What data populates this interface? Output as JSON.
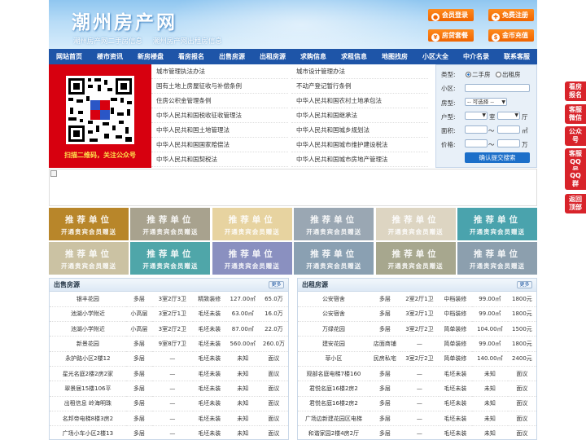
{
  "header": {
    "title": "潮州房产网",
    "subtitle": [
      "潮州房产网二手房信息",
      "潮州房产网出租房信息"
    ],
    "buttons": [
      {
        "label": "会员登录",
        "icon": "user-icon"
      },
      {
        "label": "免费注册",
        "icon": "register-icon"
      },
      {
        "label": "房贷套餐",
        "icon": "loan-icon"
      },
      {
        "label": "金币充值",
        "icon": "coin-icon"
      }
    ]
  },
  "nav": [
    "网站首页",
    "楼市资讯",
    "新房楼盘",
    "看房报名",
    "出售房源",
    "出租房源",
    "求购信息",
    "求租信息",
    "地图找房",
    "小区大全",
    "中介名录",
    "联系客服"
  ],
  "qr": {
    "caption": "扫描二维码，关注公众号"
  },
  "links": [
    [
      "城市管理执法办法",
      "城市设计管理办法"
    ],
    [
      "国有土地上房屋征收与补偿条例",
      "不动产登记暂行条例"
    ],
    [
      "住房公积金管理条例",
      "中华人民共和国农村土地承包法"
    ],
    [
      "中华人民共和国税收征收管理法",
      "中华人民共和国继承法"
    ],
    [
      "中华人民共和国土地管理法",
      "中华人民共和国城乡规划法"
    ],
    [
      "中华人民共和国国家赔偿法",
      "中华人民共和国城市维护建设税法"
    ],
    [
      "中华人民共和国契税法",
      "中华人民共和国城市房地产管理法"
    ]
  ],
  "search": {
    "type_label": "类型:",
    "type_options": [
      "二手房",
      "出租房"
    ],
    "community_label": "小区:",
    "house_type_label": "房型:",
    "house_type_value": "-- 可选择 --",
    "layout_label": "户型:",
    "room_unit": "室",
    "hall_unit": "厅",
    "area_label": "面积:",
    "area_unit": "㎡",
    "price_label": "价格:",
    "price_unit": "万",
    "range_sep": "〜",
    "submit": "确认提交搜索"
  },
  "recommend": {
    "title": "推荐单位",
    "subtitle": "开通贵宾会员赠送",
    "colors": [
      "#b8862a",
      "#a8a28e",
      "#e7d3a0",
      "#9aa7b3",
      "#ddd5c2",
      "#4aa3ad",
      "#cbc2a3",
      "#4fa6a9",
      "#8a90c0",
      "#8aa0b2",
      "#a7a78e",
      "#8c9fae"
    ]
  },
  "sale": {
    "title": "出售房源",
    "more": "更多",
    "rows": [
      [
        "银丰花园",
        "多层",
        "3室2厅3卫",
        "精致装修",
        "127.00㎡",
        "65.0万"
      ],
      [
        "池湖小学附近",
        "小高层",
        "3室2厅1卫",
        "毛坯未装",
        "63.00㎡",
        "16.0万"
      ],
      [
        "池湖小学附近",
        "小高层",
        "3室2厅2卫",
        "毛坯未装",
        "87.00㎡",
        "22.0万"
      ],
      [
        "新景花园",
        "多层",
        "9室8厅7卫",
        "毛坯未装",
        "560.00㎡",
        "260.0万"
      ],
      [
        "永护路小区2楼12",
        "多层",
        "—",
        "毛坯未装",
        "未知",
        "面议"
      ],
      [
        "星光名庭2楼2房2家",
        "多层",
        "—",
        "毛坯未装",
        "未知",
        "面议"
      ],
      [
        "翠景居15楼106平",
        "多层",
        "—",
        "毛坯未装",
        "未知",
        "面议"
      ],
      [
        "出租信息 岭海明珠",
        "多层",
        "—",
        "毛坯未装",
        "未知",
        "面议"
      ],
      [
        "名邦帝电梯8楼3房2",
        "多层",
        "—",
        "毛坯未装",
        "未知",
        "面议"
      ],
      [
        "广场小车小区2楼13",
        "多层",
        "—",
        "毛坯未装",
        "未知",
        "面议"
      ]
    ]
  },
  "rent": {
    "title": "出租房源",
    "more": "更多",
    "rows": [
      [
        "公安宿舍",
        "多层",
        "2室2厅1卫",
        "中档装修",
        "99.00㎡",
        "1800元"
      ],
      [
        "公安宿舍",
        "多层",
        "3室2厅1卫",
        "中档装修",
        "99.00㎡",
        "1800元"
      ],
      [
        "万绿花园",
        "多层",
        "3室2厅2卫",
        "简单装修",
        "104.00㎡",
        "1500元"
      ],
      [
        "建安花园",
        "店面商铺",
        "—",
        "简单装修",
        "99.00㎡",
        "1800元"
      ],
      [
        "菲小区",
        "民房私宅",
        "3室2厅2卫",
        "简单装修",
        "140.00㎡",
        "2400元"
      ],
      [
        "观部名庭电梯7楼160",
        "多层",
        "—",
        "毛坯未装",
        "未知",
        "面议"
      ],
      [
        "君悦名庭16楼2房2",
        "多层",
        "—",
        "毛坯未装",
        "未知",
        "面议"
      ],
      [
        "君悦名庭16楼2房2",
        "多层",
        "—",
        "毛坯未装",
        "未知",
        "面议"
      ],
      [
        "广场边新建花园区电梯",
        "多层",
        "—",
        "毛坯未装",
        "未知",
        "面议"
      ],
      [
        "和谐家园2楼4房2厅",
        "多层",
        "—",
        "毛坯未装",
        "未知",
        "面议"
      ]
    ]
  },
  "side": [
    "看房报名",
    "客服微信",
    "公众号",
    "客服QQ号",
    "QQ群",
    "返回顶部"
  ]
}
